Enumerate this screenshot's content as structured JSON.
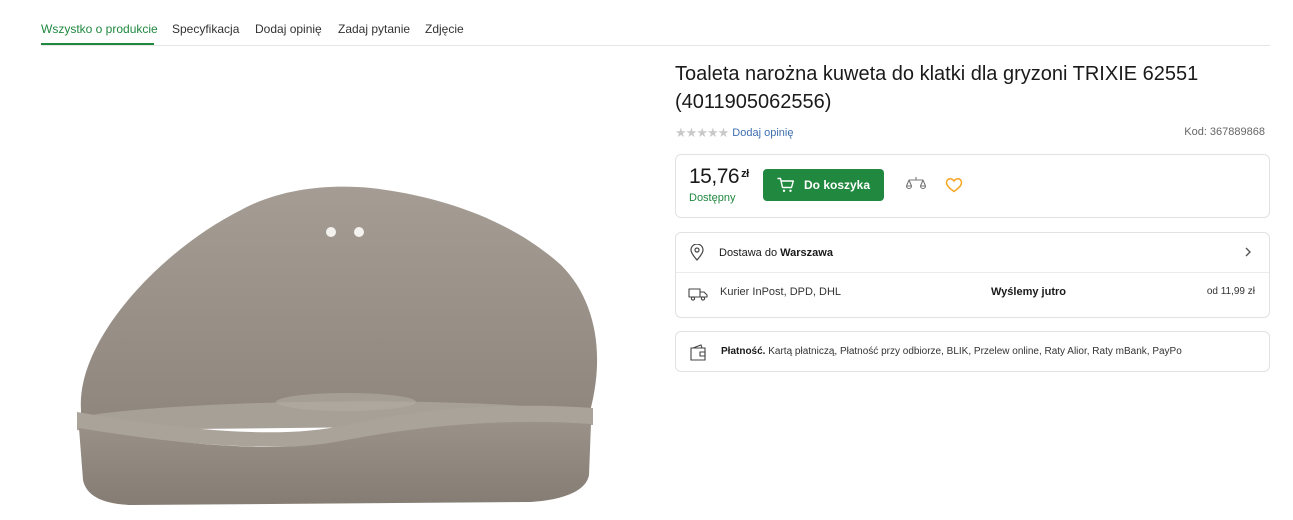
{
  "tabs": [
    {
      "label": "Wszystko o produkcie",
      "active": true
    },
    {
      "label": "Specyfikacja",
      "active": false
    },
    {
      "label": "Dodaj opinię",
      "active": false
    },
    {
      "label": "Zadaj pytanie",
      "active": false
    },
    {
      "label": "Zdjęcie",
      "active": false
    }
  ],
  "product": {
    "title_line1": "Toaleta narożna kuweta do klatki dla gryzoni TRIXIE 62551",
    "title_line2": "(4011905062556)",
    "rating": 0,
    "stars_max": 5,
    "add_review": "Dodaj opinię",
    "code": "Kod: 367889868",
    "image_icon": "rodent-corner-litter-tray"
  },
  "buy": {
    "price": "15,76",
    "currency": "zł",
    "availability": "Dostępny",
    "cart_label": "Do koszyka",
    "cart_icon": "cart-icon",
    "compare_icon": "compare-icon",
    "wishlist_icon": "heart-icon"
  },
  "delivery": {
    "prefix": "Dostawa do",
    "city": "Warszawa",
    "couriers": "Kurier InPost, DPD, DHL",
    "ship_time": "Wyślemy jutro",
    "ship_price": "od 11,99 zł"
  },
  "payment": {
    "label": "Płatność.",
    "methods": "Kartą płatniczą, Płatność przy odbiorze, BLIK, Przelew online, Raty Alior, Raty mBank, PayPo"
  },
  "colors": {
    "accent": "#20883f",
    "link": "#3f6fb0",
    "star_empty": "#c9c9c9",
    "heart": "#f5a623",
    "product_fill": "#9c948b"
  }
}
